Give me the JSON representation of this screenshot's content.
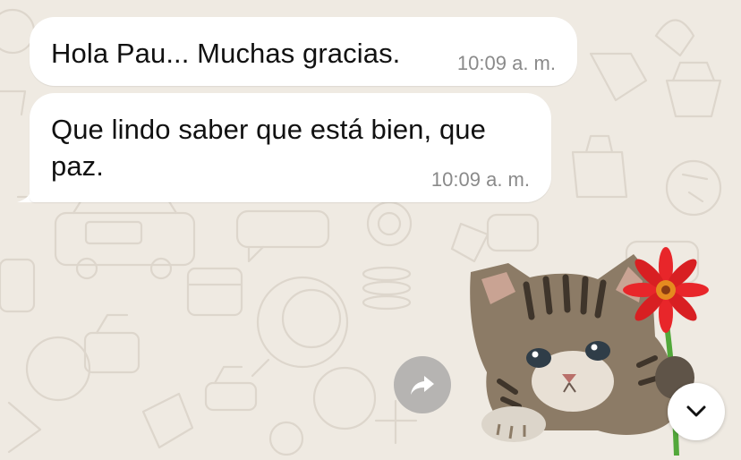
{
  "chat": {
    "messages": [
      {
        "text": "Hola Pau... Muchas gracias.",
        "time": "10:09 a. m."
      },
      {
        "text": "Que lindo saber que está bien, que paz.",
        "time": "10:09 a. m."
      }
    ],
    "sticker": {
      "description_icon": "kitten-with-flower-sticker"
    }
  },
  "controls": {
    "forward_icon": "forward-icon",
    "scroll_icon": "chevron-down-icon"
  },
  "colors": {
    "background": "#efeae2",
    "bubble": "#ffffff",
    "timestamp": "#8a8a8a",
    "flower": "#e8262a"
  }
}
